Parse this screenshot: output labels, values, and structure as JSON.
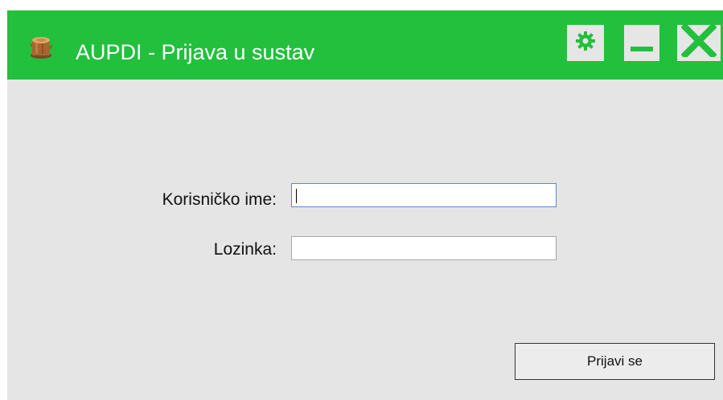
{
  "window": {
    "title": "AUPDI - Prijava u sustav",
    "app_icon": "tree-stump-icon",
    "titlebar_color": "#22c03c",
    "controls": {
      "settings_icon": "gear-icon",
      "minimize_icon": "minimize-icon",
      "close_icon": "close-icon"
    }
  },
  "form": {
    "username_label": "Korisničko ime:",
    "username_value": "",
    "password_label": "Lozinka:",
    "password_value": "",
    "submit_label": "Prijavi se"
  }
}
